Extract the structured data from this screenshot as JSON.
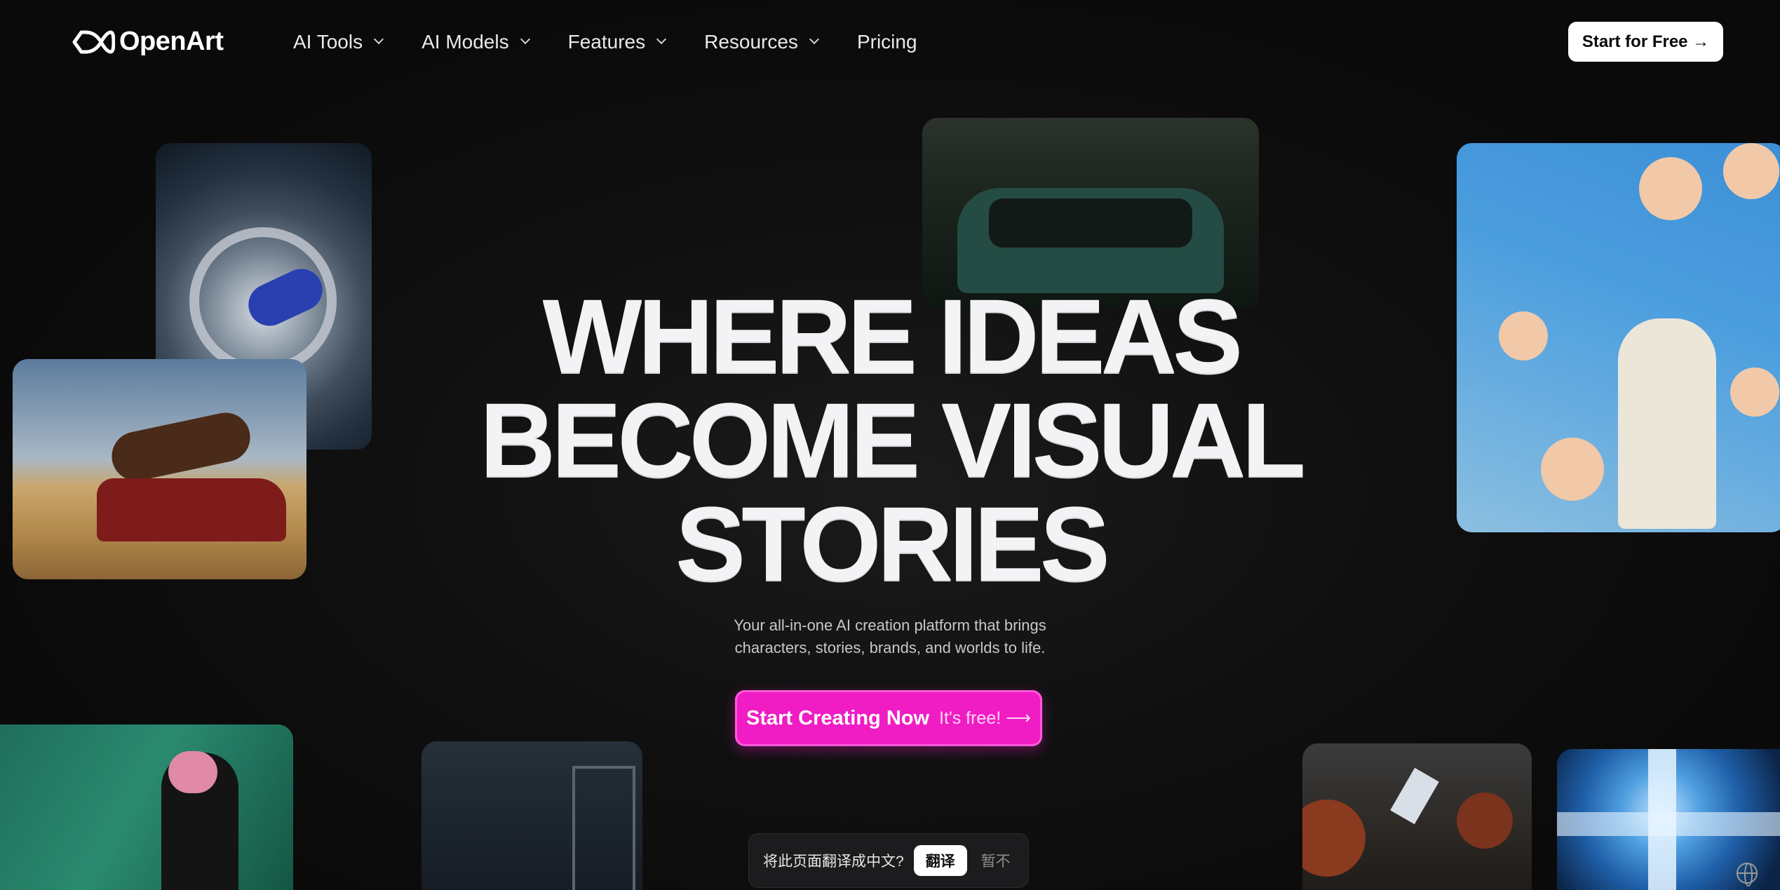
{
  "brand": {
    "name": "OpenArt"
  },
  "nav": {
    "items": [
      {
        "label": "AI Tools",
        "dropdown": true
      },
      {
        "label": "AI Models",
        "dropdown": true
      },
      {
        "label": "Features",
        "dropdown": true
      },
      {
        "label": "Resources",
        "dropdown": true
      },
      {
        "label": "Pricing",
        "dropdown": false
      }
    ],
    "cta_label": "Start for Free →"
  },
  "hero": {
    "title_lines": [
      "WHERE IDEAS",
      "BECOME VISUAL",
      "STORIES"
    ],
    "subtitle_line1": "Your all-in-one AI creation platform that brings",
    "subtitle_line2": "characters, stories, brands, and worlds to life.",
    "cta_strong": "Start Creating Now",
    "cta_light": "It's free! ⟶"
  },
  "translate_bar": {
    "question": "将此页面翻译成中文?",
    "accept": "翻译",
    "decline": "暂不"
  },
  "colors": {
    "background": "#0b0b0b",
    "accent": "#f01cc4",
    "text": "#ffffff"
  }
}
